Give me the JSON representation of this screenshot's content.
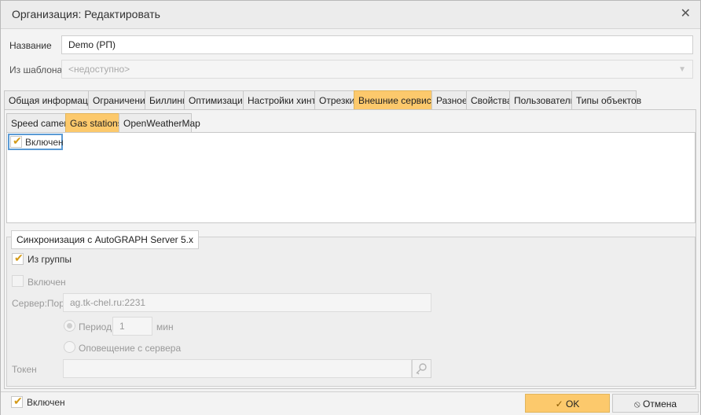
{
  "window": {
    "title": "Организация: Редактировать",
    "close_glyph": "✕"
  },
  "form": {
    "name_label": "Название",
    "name_value": "Demo (РП)",
    "template_label": "Из шаблона",
    "template_placeholder": "<недоступно>"
  },
  "main_tabs": [
    "Общая информация",
    "Ограничения",
    "Биллинг",
    "Оптимизация",
    "Настройки хинта",
    "Отрезки",
    "Внешние сервисы",
    "Разное",
    "Свойства",
    "Пользователи",
    "Типы объектов"
  ],
  "main_tab_active": "Внешние сервисы",
  "sub_tabs": [
    "Speed camera",
    "Gas stations",
    "OpenWeatherMap"
  ],
  "sub_tab_active": "Gas stations",
  "gas_panel": {
    "enabled_label": "Включен",
    "enabled_checked": true
  },
  "sync": {
    "legend": "Синхронизация с AutoGRAPH Server 5.x",
    "from_group_label": "Из группы",
    "from_group_checked": true,
    "enabled_label": "Включен",
    "enabled_checked": false,
    "server_label": "Сервер:Порт",
    "server_value": "ag.tk-chel.ru:2231",
    "period_label": "Период",
    "period_value": "1",
    "period_unit": "мин",
    "notify_label": "Оповещение с сервера",
    "token_label": "Токен",
    "token_value": ""
  },
  "footer": {
    "enabled_label": "Включен",
    "enabled_checked": true,
    "ok_label": "OK",
    "cancel_label": "Отмена"
  },
  "colors": {
    "accent": "#fcc96c",
    "check": "#d49a18",
    "focus": "#5b9bd5"
  },
  "icons": {
    "close": "close-icon",
    "check": "checkmark-icon",
    "dropdown": "chevron-down-icon",
    "key": "key-icon",
    "cancel": "ban-icon"
  }
}
